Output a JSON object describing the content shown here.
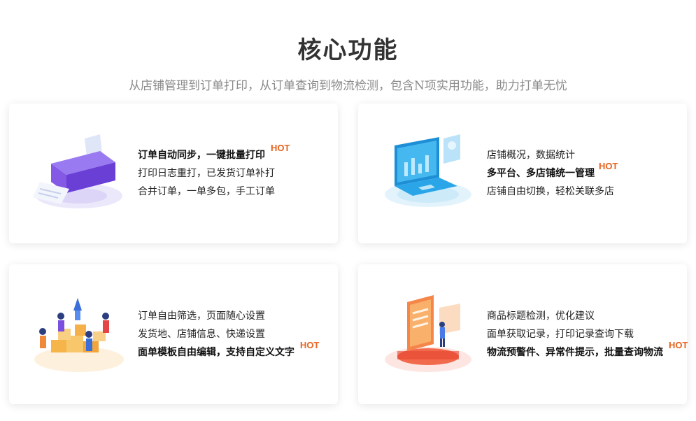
{
  "header": {
    "title": "核心功能",
    "subtitle": "从店铺管理到订单打印，从订单查询到物流检测，包含N项实用功能，助力打单无忧"
  },
  "hot_label": "HOT",
  "cards": [
    {
      "illustration": "printer-illustration",
      "lines": [
        "订单自动同步，一键批量打印",
        "打印日志重打，已发货订单补打",
        "合并订单，一单多包，手工订单"
      ],
      "hot_line": 0
    },
    {
      "illustration": "laptop-dashboard-illustration",
      "lines": [
        "店铺概况，数据统计",
        "多平台、多店铺统一管理",
        "店铺自由切换，轻松关联多店"
      ],
      "hot_line": 1
    },
    {
      "illustration": "team-boxes-illustration",
      "lines": [
        "订单自由筛选，页面随心设置",
        "发货地、店铺信息、快递设置",
        "面单模板自由编辑，支持自定义文字"
      ],
      "hot_line": 2
    },
    {
      "illustration": "document-analysis-illustration",
      "lines": [
        "商品标题检测，优化建议",
        "面单获取记录，打印记录查询下载",
        "物流预警件、异常件提示，批量查询物流"
      ],
      "hot_line": 2
    }
  ],
  "colors": {
    "hot_start": "#e8542a",
    "hot_end": "#f2a02c",
    "printer": "#7b4fe0",
    "laptop": "#2aa6e8",
    "people": "#f5a623",
    "doc": "#f0563a"
  }
}
